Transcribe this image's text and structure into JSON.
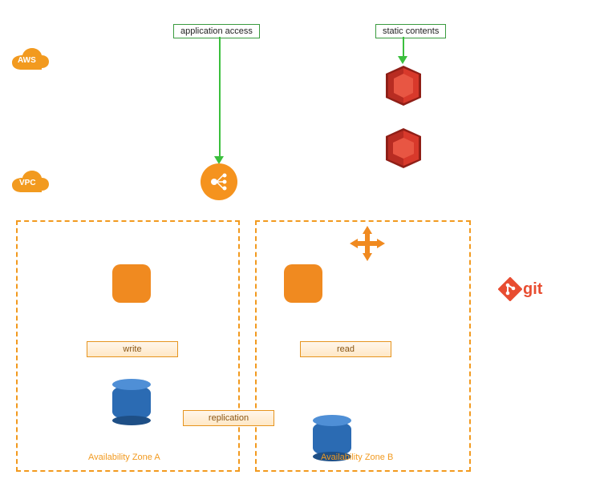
{
  "labels": {
    "app_access": "application access",
    "static_contents": "static contents",
    "aws": "AWS",
    "vpc": "VPC",
    "write": "write",
    "read": "read",
    "replication": "replication",
    "az_a": "Availability Zone A",
    "az_b": "Availability Zone B",
    "git": "git"
  },
  "icons": {
    "cloud_aws": "aws-cloud-icon",
    "cloud_vpc": "vpc-cloud-icon",
    "elb": "load-balancer-icon",
    "cloudfront": "cloudfront-icon",
    "s3": "s3-icon",
    "cross_arrows": "scale-arrows-icon",
    "ec2_a": "ec2-instance-icon",
    "ec2_b": "ec2-instance-icon",
    "rds_a": "rds-database-icon",
    "rds_b": "rds-database-icon",
    "git": "git-icon"
  },
  "colors": {
    "orange": "#f29a1f",
    "orange_fill": "#f08a20",
    "blue_db": "#2b6bb3",
    "green": "#3bbf3d",
    "git_red": "#e84d31",
    "red_service": "#c63127"
  }
}
